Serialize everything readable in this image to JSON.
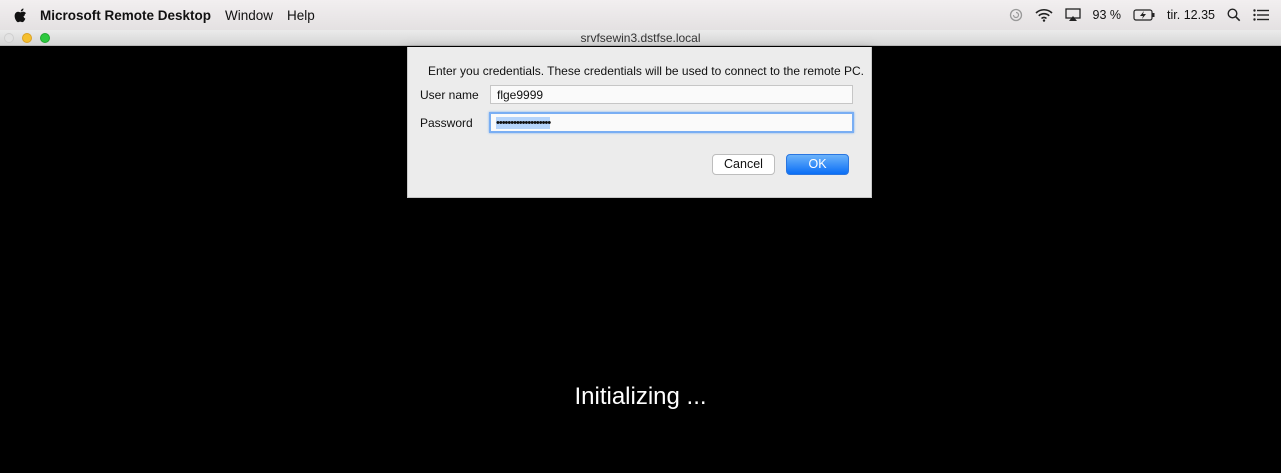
{
  "menubar": {
    "app_name": "Microsoft Remote Desktop",
    "items": [
      "Window",
      "Help"
    ],
    "status": {
      "battery": "93 %",
      "clock": "tir. 12.35"
    }
  },
  "window": {
    "title": "srvfsewin3.dstfse.local"
  },
  "sheet": {
    "message": "Enter you credentials. These credentials will be used to connect to the remote PC.",
    "username_label": "User name",
    "username_value": "flge9999",
    "password_label": "Password",
    "password_value": "•••••••••••••••••••",
    "cancel_label": "Cancel",
    "ok_label": "OK"
  },
  "remote": {
    "status_text": "Initializing ..."
  }
}
